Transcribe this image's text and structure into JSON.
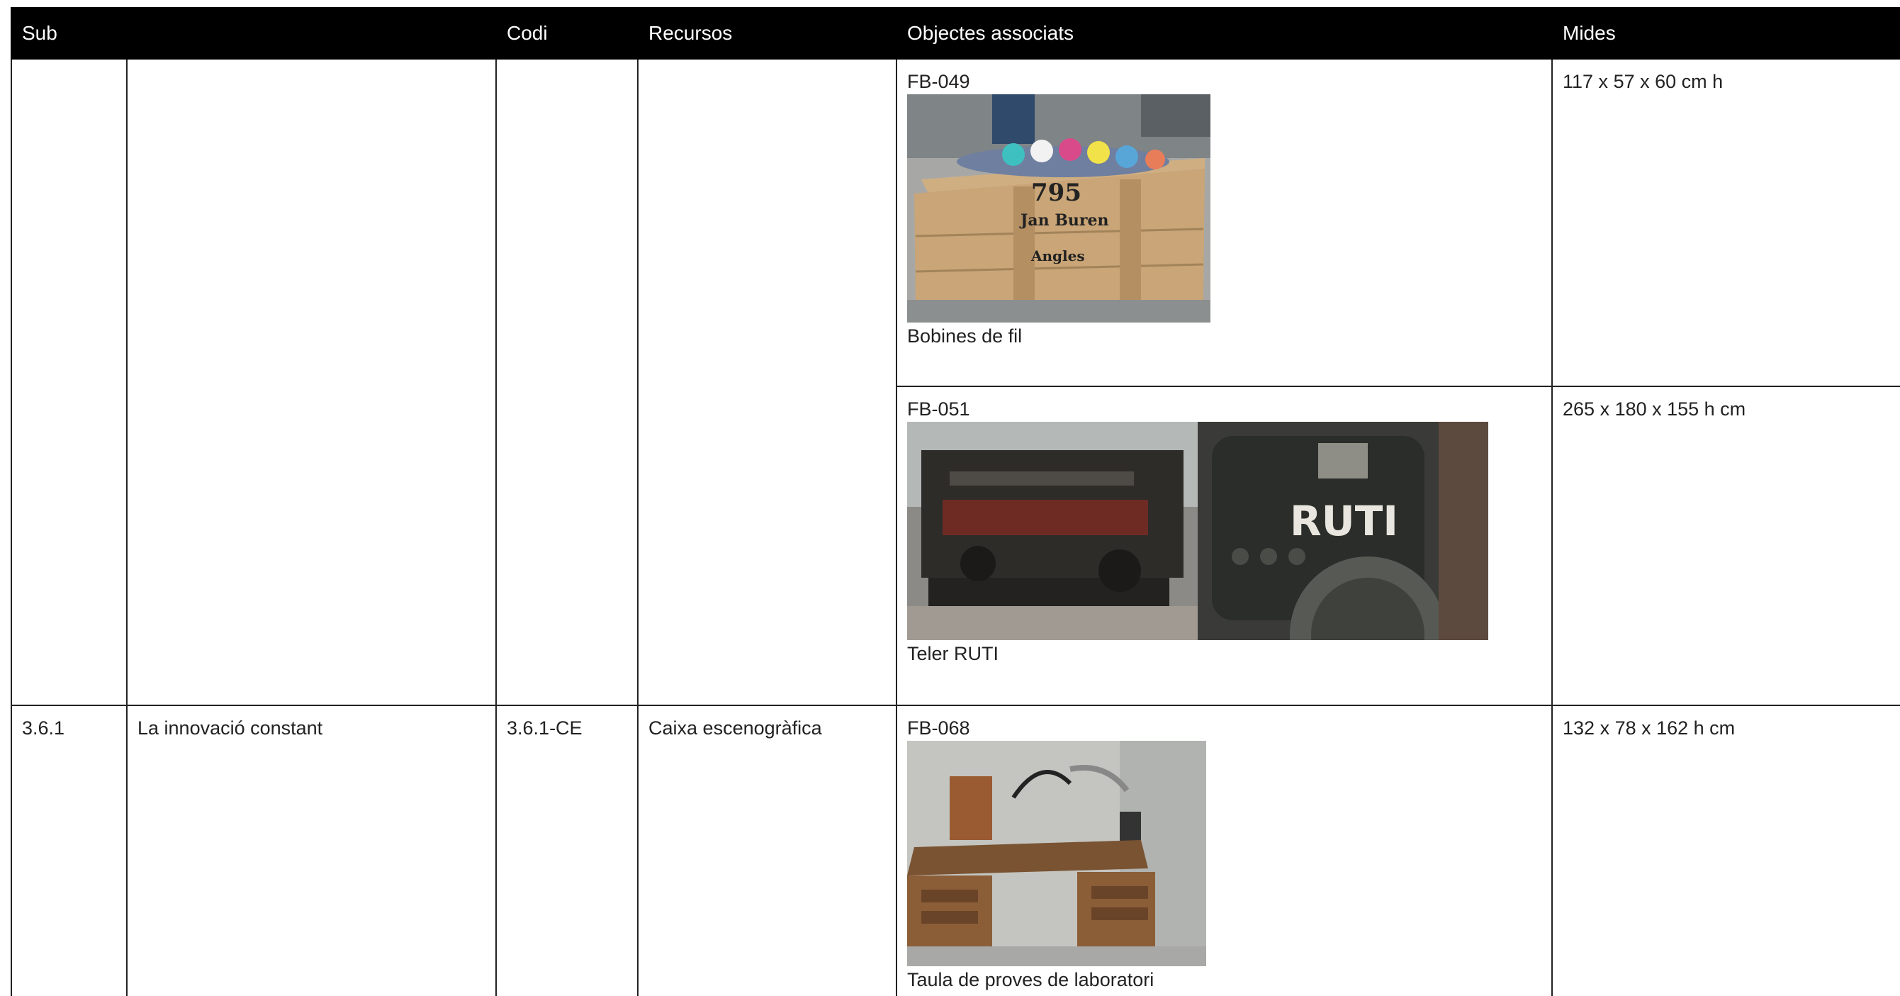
{
  "header": {
    "sub": "Sub",
    "codi": "Codi",
    "recursos": "Recursos",
    "objectes": "Objectes associats",
    "mides": "Mides"
  },
  "rows": [
    {
      "objects": [
        {
          "code": "FB-049",
          "caption": "Bobines de fil",
          "size": "117 x 57 x 60 cm h",
          "photos": [
            "crate-photo"
          ]
        },
        {
          "code": "FB-051",
          "caption": "Teler RUTI",
          "size": "265 x 180 x 155 h cm",
          "photos": [
            "loom-photo",
            "loom-plate-photo"
          ]
        }
      ]
    },
    {
      "sub_num": "3.6.1",
      "sub_title": "La innovació constant",
      "codi": "3.6.1-CE",
      "recursos": "Caixa escenogràfica",
      "objects": [
        {
          "code": "FB-068",
          "caption": "Taula de proves de laboratori",
          "size": "132 x 78 x 162 h cm",
          "photos": [
            "desk-photo"
          ]
        }
      ]
    }
  ],
  "photo_labels": {
    "crate_number": "795",
    "crate_line1": "Jan Buren",
    "crate_line2": "Angles",
    "loom_plate": "RUTI"
  }
}
